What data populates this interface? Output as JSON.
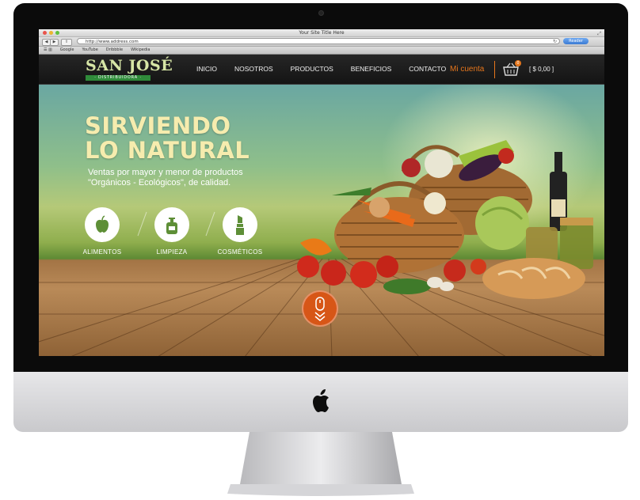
{
  "browser": {
    "window_title": "Your Site Title Here",
    "url": "http://www.address.com",
    "reader_label": "Reader",
    "bookmarks": [
      "Google",
      "YouTube",
      "Dribbble",
      "Wikipedia"
    ]
  },
  "site": {
    "logo": {
      "name": "SAN JOSÉ",
      "tagline": "· DISTRIBUIDORA ·"
    },
    "nav": [
      "INICIO",
      "NOSOTROS",
      "PRODUCTOS",
      "BENEFICIOS",
      "CONTACTO"
    ],
    "account_label": "Mi cuenta",
    "cart_count": "0",
    "cart_total": "[ $ 0,00 ]",
    "hero": {
      "title_line1": "SIRVIENDO",
      "title_line2": "LO NATURAL",
      "subtitle_line1": "Ventas por mayor y menor de productos",
      "subtitle_line2": "\"Orgánicos - Ecológicos\", de calidad.",
      "categories": [
        {
          "label": "ALIMENTOS",
          "icon": "apple-icon"
        },
        {
          "label": "LIMPIEZA",
          "icon": "soap-bottle-icon"
        },
        {
          "label": "COSMÉTICOS",
          "icon": "lipstick-icon"
        }
      ]
    },
    "colors": {
      "accent": "#e6761c",
      "logo_green": "#2f8b3a",
      "title": "#f6ecae"
    }
  }
}
